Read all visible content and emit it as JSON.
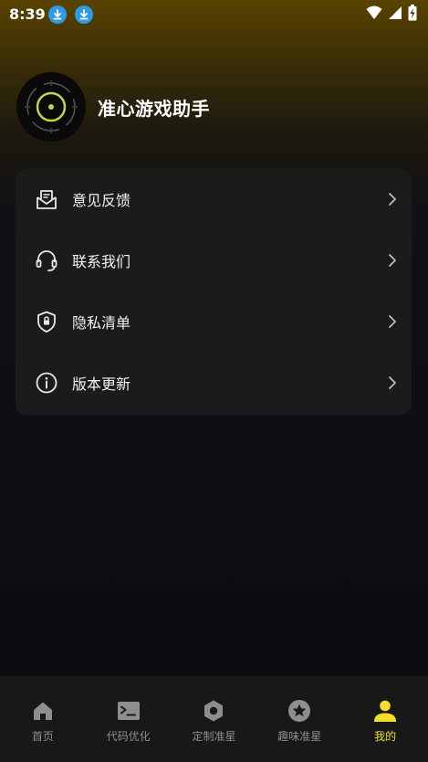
{
  "status_bar": {
    "time": "8:39"
  },
  "profile": {
    "app_name": "准心游戏助手"
  },
  "menu": {
    "items": [
      {
        "label": "意见反馈",
        "icon": "feedback-envelope-icon"
      },
      {
        "label": "联系我们",
        "icon": "headset-icon"
      },
      {
        "label": "隐私清单",
        "icon": "privacy-shield-icon"
      },
      {
        "label": "版本更新",
        "icon": "info-circle-icon"
      }
    ]
  },
  "bottom_nav": {
    "active_index": 4,
    "items": [
      {
        "label": "首页",
        "icon": "home-icon"
      },
      {
        "label": "代码优化",
        "icon": "terminal-icon"
      },
      {
        "label": "定制准星",
        "icon": "hexagon-nut-icon"
      },
      {
        "label": "趣味准星",
        "icon": "star-circle-icon"
      },
      {
        "label": "我的",
        "icon": "person-icon"
      }
    ]
  },
  "colors": {
    "accent": "#f3df2b",
    "inactive": "#8e8e8e",
    "card": "#1b1b1c",
    "nav_background": "#181819",
    "download_badge": "#2f9ae6"
  }
}
